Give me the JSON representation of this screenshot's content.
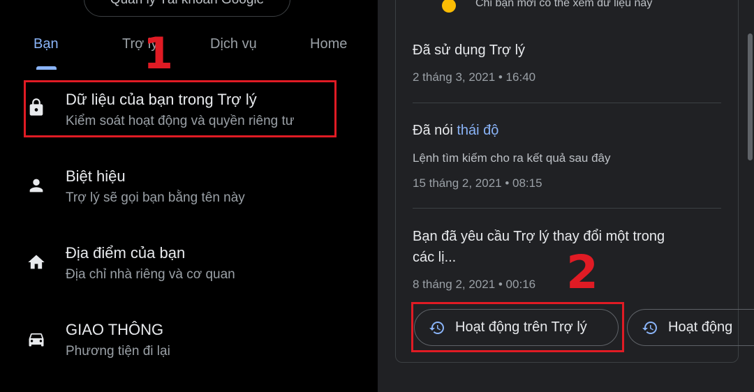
{
  "left": {
    "manage_account_label": "Quản lý Tài khoản Google",
    "tabs": [
      {
        "label": "Bạn",
        "active": true
      },
      {
        "label": "Trợ lý",
        "active": false
      },
      {
        "label": "Dịch vụ",
        "active": false
      },
      {
        "label": "Home",
        "active": false
      }
    ],
    "items": [
      {
        "title": "Dữ liệu của bạn trong Trợ lý",
        "subtitle": "Kiểm soát hoạt động và quyền riêng tư",
        "icon": "lock-icon"
      },
      {
        "title": "Biệt hiệu",
        "subtitle": "Trợ lý sẽ gọi bạn bằng tên này",
        "icon": "person-icon"
      },
      {
        "title": "Địa điểm của bạn",
        "subtitle": "Địa chỉ nhà riêng và cơ quan",
        "icon": "home-icon"
      },
      {
        "title": "GIAO THÔNG",
        "subtitle": "Phương tiện đi lại",
        "icon": "car-icon"
      }
    ]
  },
  "right": {
    "visibility_note": "Chỉ bạn mới có thể xem dữ liệu này",
    "activities": [
      {
        "title": "Đã sử dụng Trợ lý",
        "time": "2 tháng 3, 2021 • 16:40"
      },
      {
        "title_prefix": "Đã nói ",
        "title_link": "thái độ",
        "subtitle": "Lệnh tìm kiếm cho ra kết quả sau đây",
        "time": "15 tháng 2, 2021 • 08:15"
      },
      {
        "title_line1": "Bạn đã yêu cầu Trợ lý thay đổi một trong",
        "title_line2": "các lị...",
        "time": "8 tháng 2, 2021 • 00:16"
      }
    ],
    "chips": [
      {
        "label": "Hoạt động trên Trợ lý",
        "icon": "history-icon"
      },
      {
        "label": "Hoạt động",
        "icon": "history-icon"
      }
    ]
  },
  "annotations": {
    "step1": "1",
    "step2": "2",
    "color": "#e01b24"
  },
  "colors": {
    "accent": "#8ab4f8",
    "dot": "#fbbc04",
    "background": "#000000",
    "card_background": "#202124"
  }
}
